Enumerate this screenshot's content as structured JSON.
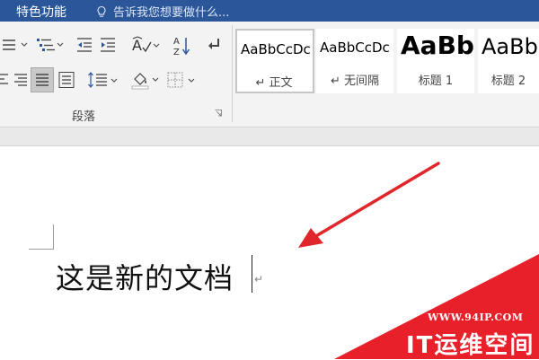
{
  "topbar": {
    "tab_label": "特色功能",
    "tell_me": "告诉我您想要做什么..."
  },
  "ribbon": {
    "paragraph_group_label": "段落",
    "styles": [
      {
        "preview": "AaBbCcDc",
        "name": "↵ 正文",
        "selected": true
      },
      {
        "preview": "AaBbCcDc",
        "name": "↵ 无间隔",
        "selected": false
      },
      {
        "preview": "AaBb",
        "name": "标题 1",
        "selected": false
      },
      {
        "preview": "AaBb",
        "name": "标题 2",
        "selected": false
      }
    ]
  },
  "document": {
    "text": "这是新的文档",
    "paragraph_mark": "↵"
  },
  "watermark": {
    "url": "WWW.94IP.COM",
    "title": "IT运维空间"
  },
  "colors": {
    "ribbon_blue": "#2b579a",
    "arrow_red": "#e0262b",
    "watermark_red": "#e8202a"
  }
}
